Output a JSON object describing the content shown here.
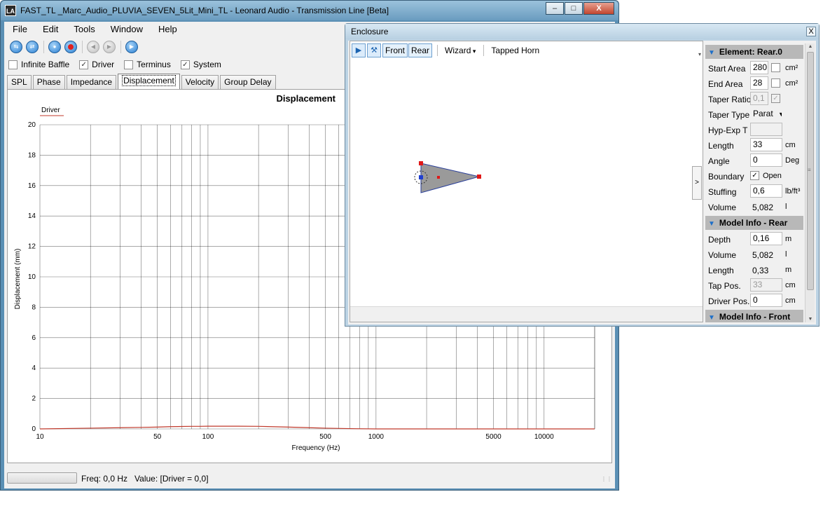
{
  "main_window": {
    "title": "FAST_TL _Marc_Audio_PLUVIA_SEVEN_5Lit_Mini_TL - Leonard Audio - Transmission Line [Beta]",
    "logo": "LA",
    "controls": {
      "minimize": "–",
      "maximize": "□",
      "close": "X"
    },
    "menu": [
      "File",
      "Edit",
      "Tools",
      "Window",
      "Help"
    ],
    "toolbar_icons": [
      "import-icon",
      "export-icon",
      "play-icon",
      "record-icon",
      "back-icon",
      "forward-icon",
      "run-icon"
    ],
    "checkboxes": [
      {
        "label": "Infinite Baffle",
        "checked": false
      },
      {
        "label": "Driver",
        "checked": true
      },
      {
        "label": "Terminus",
        "checked": false
      },
      {
        "label": "System",
        "checked": true
      }
    ],
    "tabs": [
      "SPL",
      "Phase",
      "Impedance",
      "Displacement",
      "Velocity",
      "Group Delay"
    ],
    "active_tab": "Displacement",
    "status": {
      "freq": "Freq: 0,0 Hz",
      "value": "Value: [Driver = 0,0]"
    }
  },
  "chart_data": {
    "type": "line",
    "title": "Displacement",
    "xlabel": "Frequency (Hz)",
    "ylabel": "Displacement (mm)",
    "x_scale": "log",
    "xlim": [
      10,
      20000
    ],
    "ylim": [
      0,
      20
    ],
    "x_ticks": [
      10,
      50,
      100,
      500,
      1000,
      5000,
      10000
    ],
    "y_ticks": [
      0,
      2,
      4,
      6,
      8,
      10,
      12,
      14,
      16,
      18,
      20
    ],
    "grid": true,
    "legend": "top-left",
    "series": [
      {
        "name": "Driver",
        "color": "#c0392b",
        "x": [
          10,
          20,
          30,
          40,
          50,
          60,
          70,
          80,
          90,
          100,
          150,
          200,
          300,
          400,
          500,
          700,
          1000,
          5000,
          20000
        ],
        "y": [
          0.0,
          0.05,
          0.08,
          0.1,
          0.12,
          0.15,
          0.16,
          0.17,
          0.17,
          0.18,
          0.18,
          0.17,
          0.12,
          0.08,
          0.05,
          0.02,
          0.0,
          0.0,
          0.0
        ]
      }
    ]
  },
  "enclosure_window": {
    "title": "Enclosure",
    "close": "X",
    "toolbar": {
      "front": "Front",
      "rear": "Rear",
      "wizard": "Wizard",
      "tapped_horn": "Tapped Horn"
    },
    "overflow": "▾",
    "expand": ">",
    "sections": [
      {
        "title": "Element: Rear.0"
      },
      {
        "title": "Model Info - Rear"
      },
      {
        "title": "Model Info - Front"
      }
    ],
    "element": {
      "start_area": {
        "label": "Start Area",
        "value": "280",
        "unit": "cm²"
      },
      "end_area": {
        "label": "End Area",
        "value": "28",
        "unit": "cm²"
      },
      "taper_ratio": {
        "label": "Taper Ratio",
        "value": "0,1"
      },
      "taper_type": {
        "label": "Taper Type",
        "value": "Parat"
      },
      "hyp_exp": {
        "label": "Hyp-Exp T",
        "value": ""
      },
      "length": {
        "label": "Length",
        "value": "33",
        "unit": "cm"
      },
      "angle": {
        "label": "Angle",
        "value": "0",
        "unit": "Deg"
      },
      "boundary": {
        "label": "Boundary",
        "option": "Open",
        "checked": true
      },
      "stuffing": {
        "label": "Stuffing",
        "value": "0,6",
        "unit": "lb/ft³"
      },
      "volume": {
        "label": "Volume",
        "value": "5,082",
        "unit": "l"
      }
    },
    "model_rear": {
      "depth": {
        "label": "Depth",
        "value": "0,16",
        "unit": "m"
      },
      "volume": {
        "label": "Volume",
        "value": "5,082",
        "unit": "l"
      },
      "length": {
        "label": "Length",
        "value": "0,33",
        "unit": "m"
      },
      "tap_pos": {
        "label": "Tap Pos.",
        "value": "33",
        "unit": "cm"
      },
      "driver_pos": {
        "label": "Driver Pos.",
        "value": "0",
        "unit": "cm"
      }
    }
  }
}
